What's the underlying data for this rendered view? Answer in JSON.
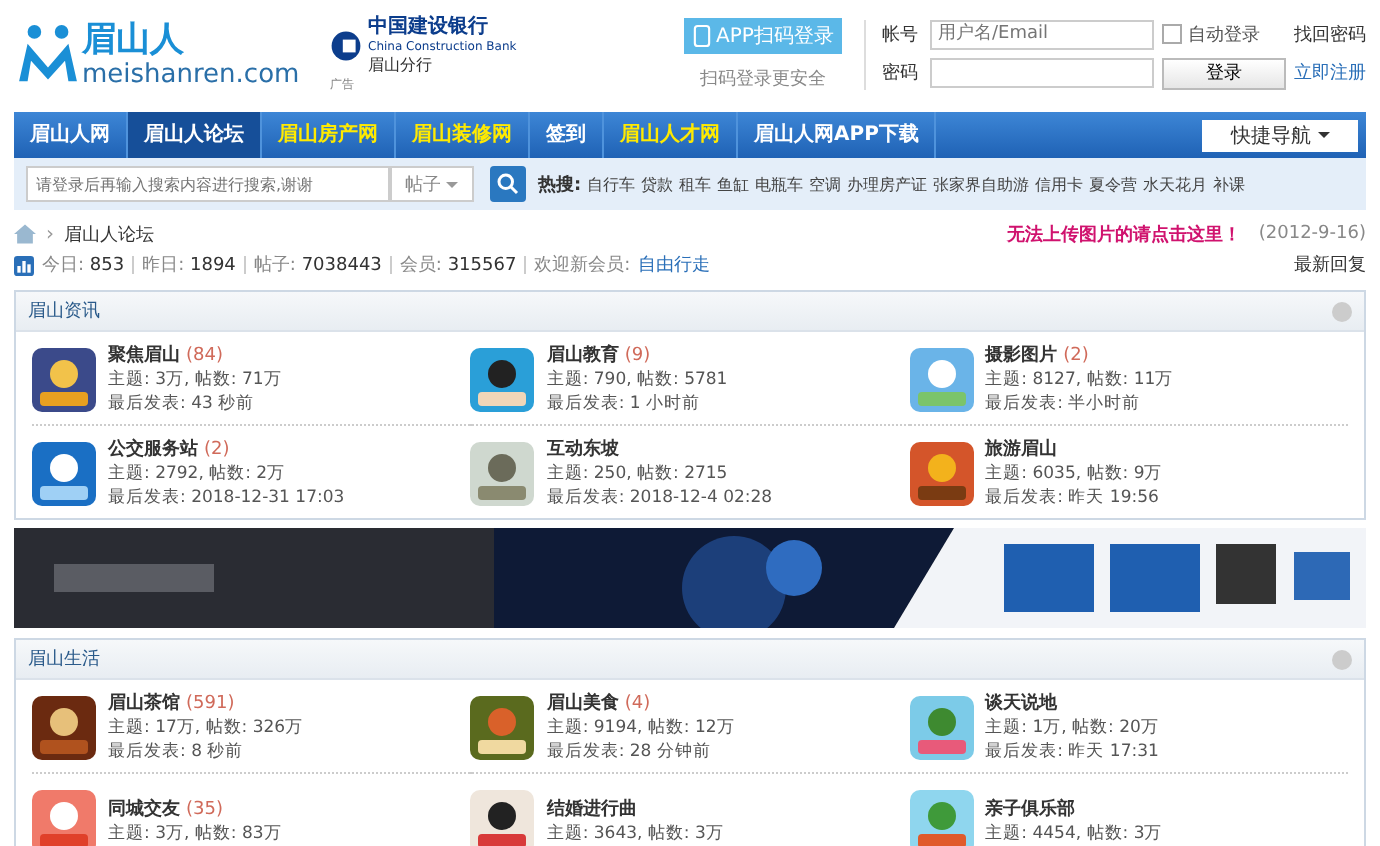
{
  "header": {
    "logo": {
      "name": "眉山人",
      "domain": "meishanren.com"
    },
    "ad": {
      "bank": "中国建设银行",
      "bank_en": "China Construction Bank",
      "branch": "眉山分行",
      "tag": "广告"
    },
    "app_login": {
      "button": "APP扫码登录",
      "hint": "扫码登录更安全"
    },
    "login": {
      "account_label": "帐号",
      "account_placeholder": "用户名/Email",
      "remember": {
        "label": "自动登录",
        "checked": false
      },
      "forgot": "找回密码",
      "password_label": "密码",
      "submit": "登录",
      "register": "立即注册"
    }
  },
  "nav": {
    "items": [
      {
        "label": "眉山人网",
        "selected": false,
        "highlight": false
      },
      {
        "label": "眉山人论坛",
        "selected": true,
        "highlight": false
      },
      {
        "label": "眉山房产网",
        "selected": false,
        "highlight": true
      },
      {
        "label": "眉山装修网",
        "selected": false,
        "highlight": true
      },
      {
        "label": "签到",
        "selected": false,
        "highlight": false
      },
      {
        "label": "眉山人才网",
        "selected": false,
        "highlight": true
      },
      {
        "label": "眉山人网APP下载",
        "selected": false,
        "highlight": false
      }
    ],
    "quick_nav": "快捷导航"
  },
  "search": {
    "placeholder": "请登录后再输入搜索内容进行搜索,谢谢",
    "scope": "帖子",
    "hot_label": "热搜:",
    "hot": [
      "自行车",
      "贷款",
      "租车",
      "鱼缸",
      "电瓶车",
      "空调",
      "办理房产证",
      "张家界自助游",
      "信用卡",
      "夏令营",
      "水天花月",
      "补课"
    ]
  },
  "breadcrumb": {
    "separator": "›",
    "current": "眉山人论坛",
    "notice": "无法上传图片的请点击这里！",
    "date": "(2012-9-16)"
  },
  "stats": {
    "items": [
      {
        "label": "今日:",
        "value": "853"
      },
      {
        "label": "昨日:",
        "value": "1894"
      },
      {
        "label": "帖子:",
        "value": "7038443"
      },
      {
        "label": "会员:",
        "value": "315567"
      }
    ],
    "welcome": "欢迎新会员:",
    "new_member": "自由行走",
    "latest": "最新回复"
  },
  "sections": [
    {
      "title": "眉山资讯",
      "forums": [
        {
          "name": "聚焦眉山",
          "count": "(84)",
          "stats": "主题: 3万, 帖数: 71万",
          "last": "最后发表: 43 秒前"
        },
        {
          "name": "眉山教育",
          "count": "(9)",
          "stats": "主题: 790, 帖数: 5781",
          "last": "最后发表: 1 小时前"
        },
        {
          "name": "摄影图片",
          "count": "(2)",
          "stats": "主题: 8127, 帖数: 11万",
          "last": "最后发表: 半小时前"
        },
        {
          "name": "公交服务站",
          "count": "(2)",
          "stats": "主题: 2792, 帖数: 2万",
          "last": "最后发表: 2018-12-31 17:03"
        },
        {
          "name": "互动东坡",
          "stats": "主题: 250, 帖数: 2715",
          "last": "最后发表: 2018-12-4 02:28"
        },
        {
          "name": "旅游眉山",
          "stats": "主题: 6035, 帖数: 9万",
          "last": "最后发表: 昨天 19:56"
        }
      ]
    },
    {
      "title": "眉山生活",
      "forums": [
        {
          "name": "眉山茶馆",
          "count": "(591)",
          "stats": "主题: 17万, 帖数: 326万",
          "last": "最后发表: 8 秒前"
        },
        {
          "name": "眉山美食",
          "count": "(4)",
          "stats": "主题: 9194, 帖数: 12万",
          "last": "最后发表: 28 分钟前"
        },
        {
          "name": "谈天说地",
          "stats": "主题: 1万, 帖数: 20万",
          "last": "最后发表: 昨天 17:31"
        },
        {
          "name": "同城交友",
          "count": "(35)",
          "stats": "主题: 3万, 帖数: 83万"
        },
        {
          "name": "结婚进行曲",
          "stats": "主题: 3643, 帖数: 3万"
        },
        {
          "name": "亲子俱乐部",
          "stats": "主题: 4454, 帖数: 3万"
        }
      ]
    }
  ]
}
